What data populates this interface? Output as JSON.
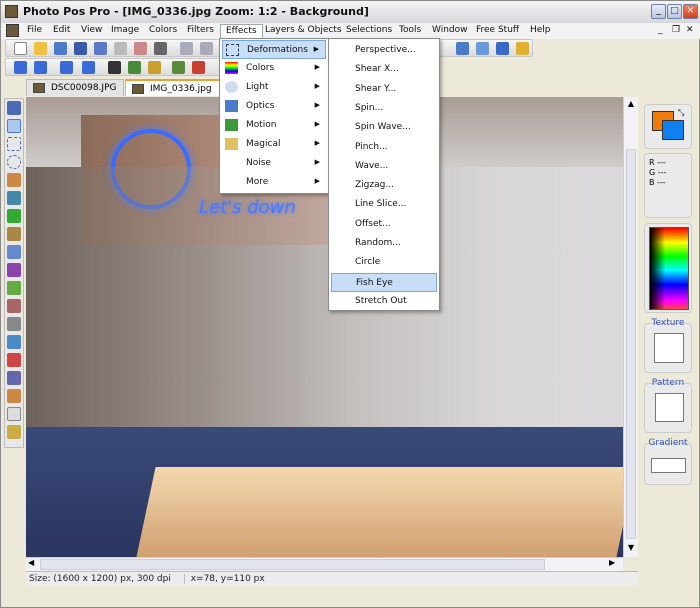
{
  "window": {
    "title": "Photo Pos Pro - [IMG_0336.jpg  Zoom: 1:2 - Background]"
  },
  "menubar": {
    "items": [
      "File",
      "Edit",
      "View",
      "Image",
      "Colors",
      "Filters",
      "Effects",
      "Layers & Objects",
      "Selections",
      "Tools",
      "Window",
      "Free Stuff",
      "Help"
    ],
    "active": "Effects"
  },
  "tabs": [
    {
      "label": "DSC00098.JPG"
    },
    {
      "label": "IMG_0336.jpg",
      "selected": true
    }
  ],
  "effects_menu": {
    "items": [
      {
        "label": "Deformations",
        "icon": "deformations-icon",
        "highlighted": true
      },
      {
        "label": "Colors",
        "icon": "colors-icon"
      },
      {
        "label": "Light",
        "icon": "light-bulb-icon"
      },
      {
        "label": "Optics",
        "icon": "optics-icon"
      },
      {
        "label": "Motion",
        "icon": "motion-icon"
      },
      {
        "label": "Magical",
        "icon": "magical-icon"
      },
      {
        "label": "Noise",
        "icon": "noise-icon"
      },
      {
        "label": "More",
        "icon": "more-icon"
      }
    ]
  },
  "deformations_submenu": {
    "items": [
      "Perspective...",
      "Shear X...",
      "Shear Y...",
      "Spin...",
      "Spin Wave...",
      "Pinch...",
      "Wave...",
      "Zigzag...",
      "Line Slice...",
      "Offset...",
      "Random...",
      "Circle",
      "Fish Eye",
      "Stretch Out"
    ],
    "highlighted": "Fish Eye"
  },
  "image": {
    "sign_text": "Let's down"
  },
  "color_panel": {
    "foreground": "#f07c10",
    "background": "#1080f0",
    "r": "R ---",
    "g": "G ---",
    "b": "B ---"
  },
  "panels": {
    "texture": "Texture",
    "pattern": "Pattern",
    "gradient": "Gradient"
  },
  "status": {
    "size": "Size: (1600 x 1200) px, 300 dpi",
    "coords": "x=78, y=110 px"
  }
}
